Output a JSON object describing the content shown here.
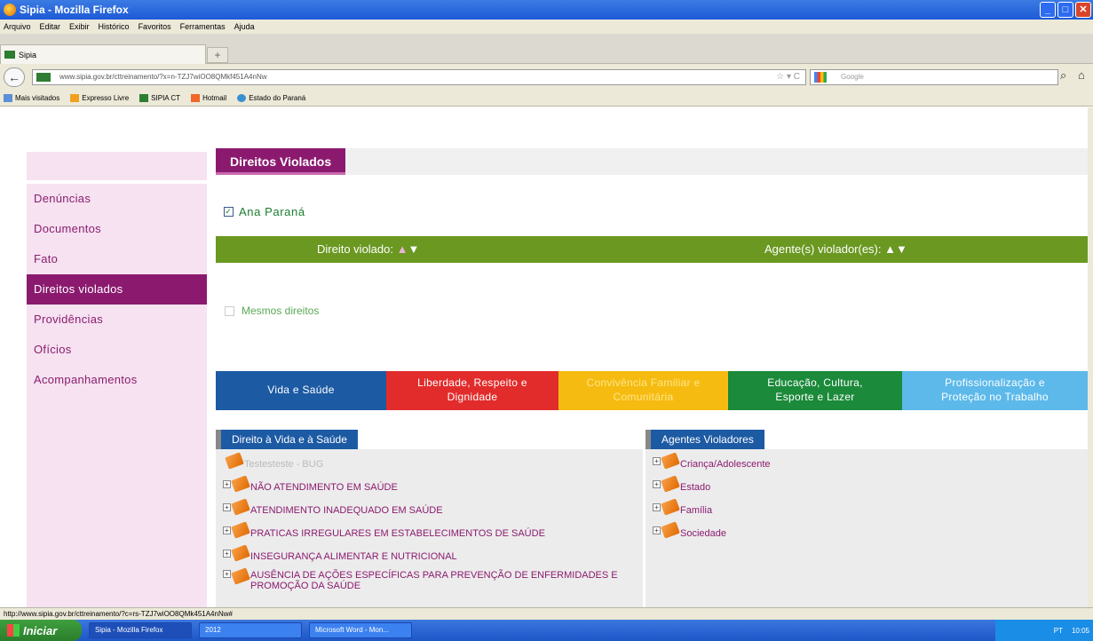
{
  "window": {
    "title": "Sipia - Mozilla Firefox"
  },
  "menu": [
    "Arquivo",
    "Editar",
    "Exibir",
    "Histórico",
    "Favoritos",
    "Ferramentas",
    "Ajuda"
  ],
  "tab": {
    "label": "Sipia"
  },
  "address": {
    "url": "www.sipia.gov.br/cttreinamento/?x=n-TZJ7wiOO8QMkf451A4nNw",
    "search_placeholder": "Google"
  },
  "bookmarks": [
    "Mais visitados",
    "Expresso Livre",
    "SIPIA CT",
    "Hotmail",
    "Estado do Paraná"
  ],
  "sidebar": {
    "items": [
      {
        "label": "Denúncias",
        "active": false
      },
      {
        "label": "Documentos",
        "active": false
      },
      {
        "label": "Fato",
        "active": false
      },
      {
        "label": "Direitos violados",
        "active": true
      },
      {
        "label": "Providências",
        "active": false
      },
      {
        "label": "Ofícios",
        "active": false
      },
      {
        "label": "Acompanhamentos",
        "active": false
      }
    ]
  },
  "section": {
    "title": "Direitos Violados"
  },
  "person": {
    "name": "Ana Paraná",
    "checked": true
  },
  "columns": {
    "direito": "Direito violado:",
    "agentes": "Agente(s) violador(es):"
  },
  "mesmos": {
    "label": "Mesmos direitos",
    "checked": false
  },
  "rights_tabs": [
    {
      "label": "Vida e Saúde",
      "color": "#1c5aa4"
    },
    {
      "label": "Liberdade, Respeito e\nDignidade",
      "color": "#e12c2b"
    },
    {
      "label": "Convivência Familiar e\nComunitária",
      "color": "#f6bb10"
    },
    {
      "label": "Educação, Cultura,\nEsporte e Lazer",
      "color": "#1b8a3a"
    },
    {
      "label": "Profissionalização e\nProteção no Trabalho",
      "color": "#5cb9ea"
    }
  ],
  "left_panel": {
    "title": "Direito à Vida e à Saúde",
    "items": [
      {
        "label": "Testesteste - BUG",
        "disabled": true
      },
      {
        "label": "NÃO ATENDIMENTO EM SAÚDE",
        "disabled": false
      },
      {
        "label": "ATENDIMENTO INADEQUADO EM SAÚDE",
        "disabled": false
      },
      {
        "label": "PRATICAS IRREGULARES EM ESTABELECIMENTOS DE SAÚDE",
        "disabled": false
      },
      {
        "label": "INSEGURANÇA ALIMENTAR E NUTRICIONAL",
        "disabled": false
      },
      {
        "label": "AUSÊNCIA DE AÇÕES ESPECÍFICAS PARA PREVENÇÃO DE ENFERMIDADES E PROMOÇÃO DA SAÚDE",
        "disabled": false
      }
    ]
  },
  "right_panel": {
    "title": "Agentes Violadores",
    "items": [
      "Criança/Adolescente",
      "Estado",
      "Família",
      "Sociedade"
    ]
  },
  "status": {
    "text": "http://www.sipia.gov.br/cttreinamento/?c=rs-TZJ7wiOO8QMk451A4nNw#"
  },
  "taskbar": {
    "start": "Iniciar",
    "items": [
      "Sipia - Mozilla Firefox",
      "2012",
      "Microsoft Word - Mon..."
    ],
    "lang": "PT",
    "time": "10:05"
  },
  "colors": {
    "accent": "#8b1a6f",
    "green": "#6a9821",
    "blue": "#1c5aa4"
  }
}
